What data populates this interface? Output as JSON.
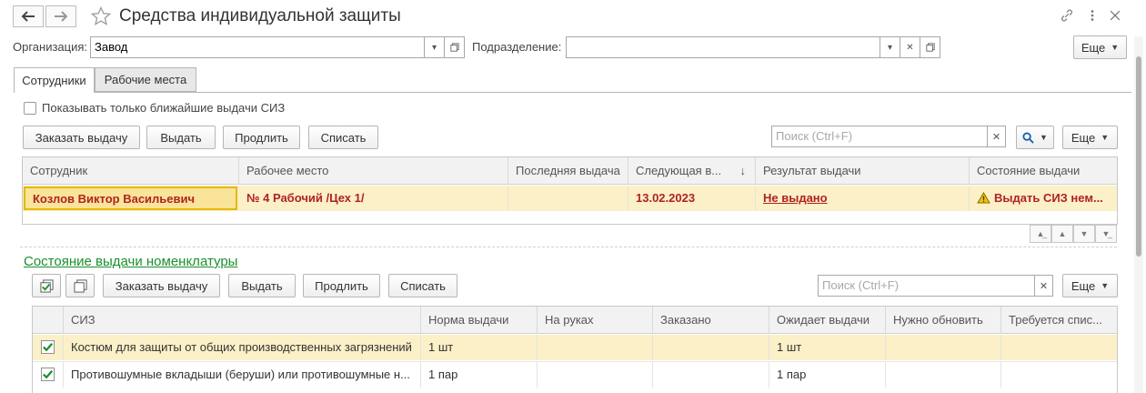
{
  "window": {
    "title": "Средства индивидуальной защиты",
    "header_icons": [
      "link-icon",
      "kebab-menu-icon",
      "close-icon"
    ]
  },
  "filters": {
    "organization_label": "Организация:",
    "organization_value": "Завод",
    "subdivision_label": "Подразделение:",
    "subdivision_value": "",
    "more_label": "Еще"
  },
  "tabs": [
    {
      "label": "Сотрудники",
      "active": true
    },
    {
      "label": "Рабочие места",
      "active": false
    }
  ],
  "employees": {
    "show_nearest_label": "Показывать только ближайшие выдачи СИЗ",
    "show_nearest_checked": false,
    "buttons": {
      "order": "Заказать выдачу",
      "issue": "Выдать",
      "extend": "Продлить",
      "write_off": "Списать",
      "more": "Еще"
    },
    "search_placeholder": "Поиск (Ctrl+F)",
    "columns": [
      "Сотрудник",
      "Рабочее место",
      "Последняя выдача",
      "Следующая в...",
      "Результат выдачи",
      "Состояние выдачи"
    ],
    "rows": [
      {
        "employee": "Козлов Виктор Васильевич",
        "workplace": "№ 4 Рабочий /Цех 1/",
        "last_issue": "",
        "next_issue": "13.02.2023",
        "result": "Не выдано",
        "state": "Выдать СИЗ нем..."
      }
    ]
  },
  "nomenclature": {
    "section_title": "Состояние выдачи номенклатуры",
    "buttons": {
      "order": "Заказать выдачу",
      "issue": "Выдать",
      "extend": "Продлить",
      "write_off": "Списать",
      "more": "Еще"
    },
    "search_placeholder": "Поиск (Ctrl+F)",
    "columns": [
      "СИЗ",
      "Норма выдачи",
      "На руках",
      "Заказано",
      "Ожидает выдачи",
      "Нужно обновить",
      "Требуется спис..."
    ],
    "rows": [
      {
        "checked": true,
        "item": "Костюм для защиты от общих производственных загрязнений",
        "norm": "1 шт",
        "on_hand": "",
        "ordered": "",
        "awaiting": "1 шт",
        "need_update": "",
        "write_off": ""
      },
      {
        "checked": true,
        "item": "Противошумные вкладыши (беруши) или противошумные н...",
        "norm": "1 пар",
        "on_hand": "",
        "ordered": "",
        "awaiting": "1 пар",
        "need_update": "",
        "write_off": ""
      }
    ]
  },
  "colors": {
    "accent_green": "#1a8f2d",
    "selected_row": "#fbf0c8",
    "red_text": "#b0231f"
  }
}
